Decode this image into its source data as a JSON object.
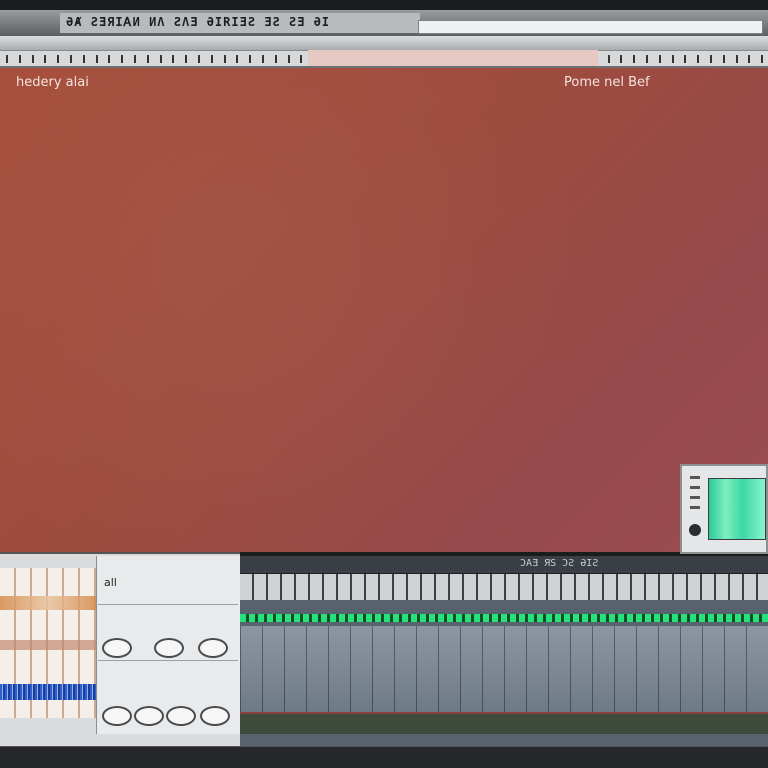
{
  "window": {
    "title": "ƏȺ ƧƎЯIᎪИ   ИΛ ƧΛƎ ƏIRIƎƧ ƎƧ ƧƎ ƏI"
  },
  "canvas": {
    "left_label": "hedery alai",
    "right_label": "Pome nel Bef"
  },
  "left_panel": {
    "label": "all"
  },
  "sequencer": {
    "title": "ƆAƎ ЯS ƆƧ   ƏIƧ"
  },
  "status": {
    "text": ""
  },
  "colors": {
    "canvas": "#9f4b40",
    "meter_green": "#27e27a",
    "monitor_screen": "#3bd7a6"
  }
}
